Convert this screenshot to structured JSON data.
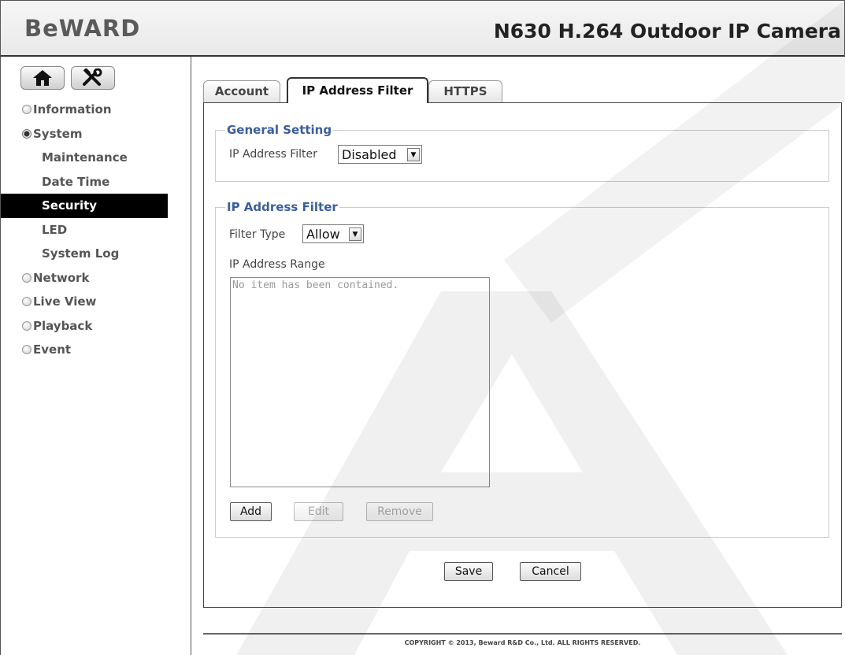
{
  "header": {
    "logo": "BeWARD",
    "camera_title": "N630 H.264 Outdoor IP Camera"
  },
  "toolbar": {
    "home_icon": "home-icon",
    "tools_icon": "tools-icon"
  },
  "sidebar": {
    "items": [
      {
        "label": "Information",
        "state": "closed"
      },
      {
        "label": "System",
        "state": "open"
      },
      {
        "label": "Network",
        "state": "closed"
      },
      {
        "label": "Live View",
        "state": "closed"
      },
      {
        "label": "Playback",
        "state": "closed"
      },
      {
        "label": "Event",
        "state": "closed"
      }
    ],
    "system_sub": [
      {
        "label": "Maintenance",
        "active": false
      },
      {
        "label": "Date Time",
        "active": false
      },
      {
        "label": "Security",
        "active": true
      },
      {
        "label": "LED",
        "active": false
      },
      {
        "label": "System Log",
        "active": false
      }
    ]
  },
  "tabs": [
    {
      "label": "Account",
      "active": false
    },
    {
      "label": "IP Address Filter",
      "active": true
    },
    {
      "label": "HTTPS",
      "active": false
    }
  ],
  "general": {
    "legend": "General Setting",
    "filter_label": "IP Address Filter",
    "filter_value": "Disabled"
  },
  "ipfilter": {
    "legend": "IP Address Filter",
    "type_label": "Filter Type",
    "type_value": "Allow",
    "range_label": "IP Address Range",
    "empty_text": "No item has been contained.",
    "add": "Add",
    "edit": "Edit",
    "remove": "Remove"
  },
  "actions": {
    "save": "Save",
    "cancel": "Cancel"
  },
  "footer": {
    "copyright": "COPYRIGHT © 2013, Beward R&D Co., Ltd. ALL RIGHTS RESERVED."
  },
  "colors": {
    "legend": "#3b5f9e",
    "active_nav_bg": "#000000"
  }
}
